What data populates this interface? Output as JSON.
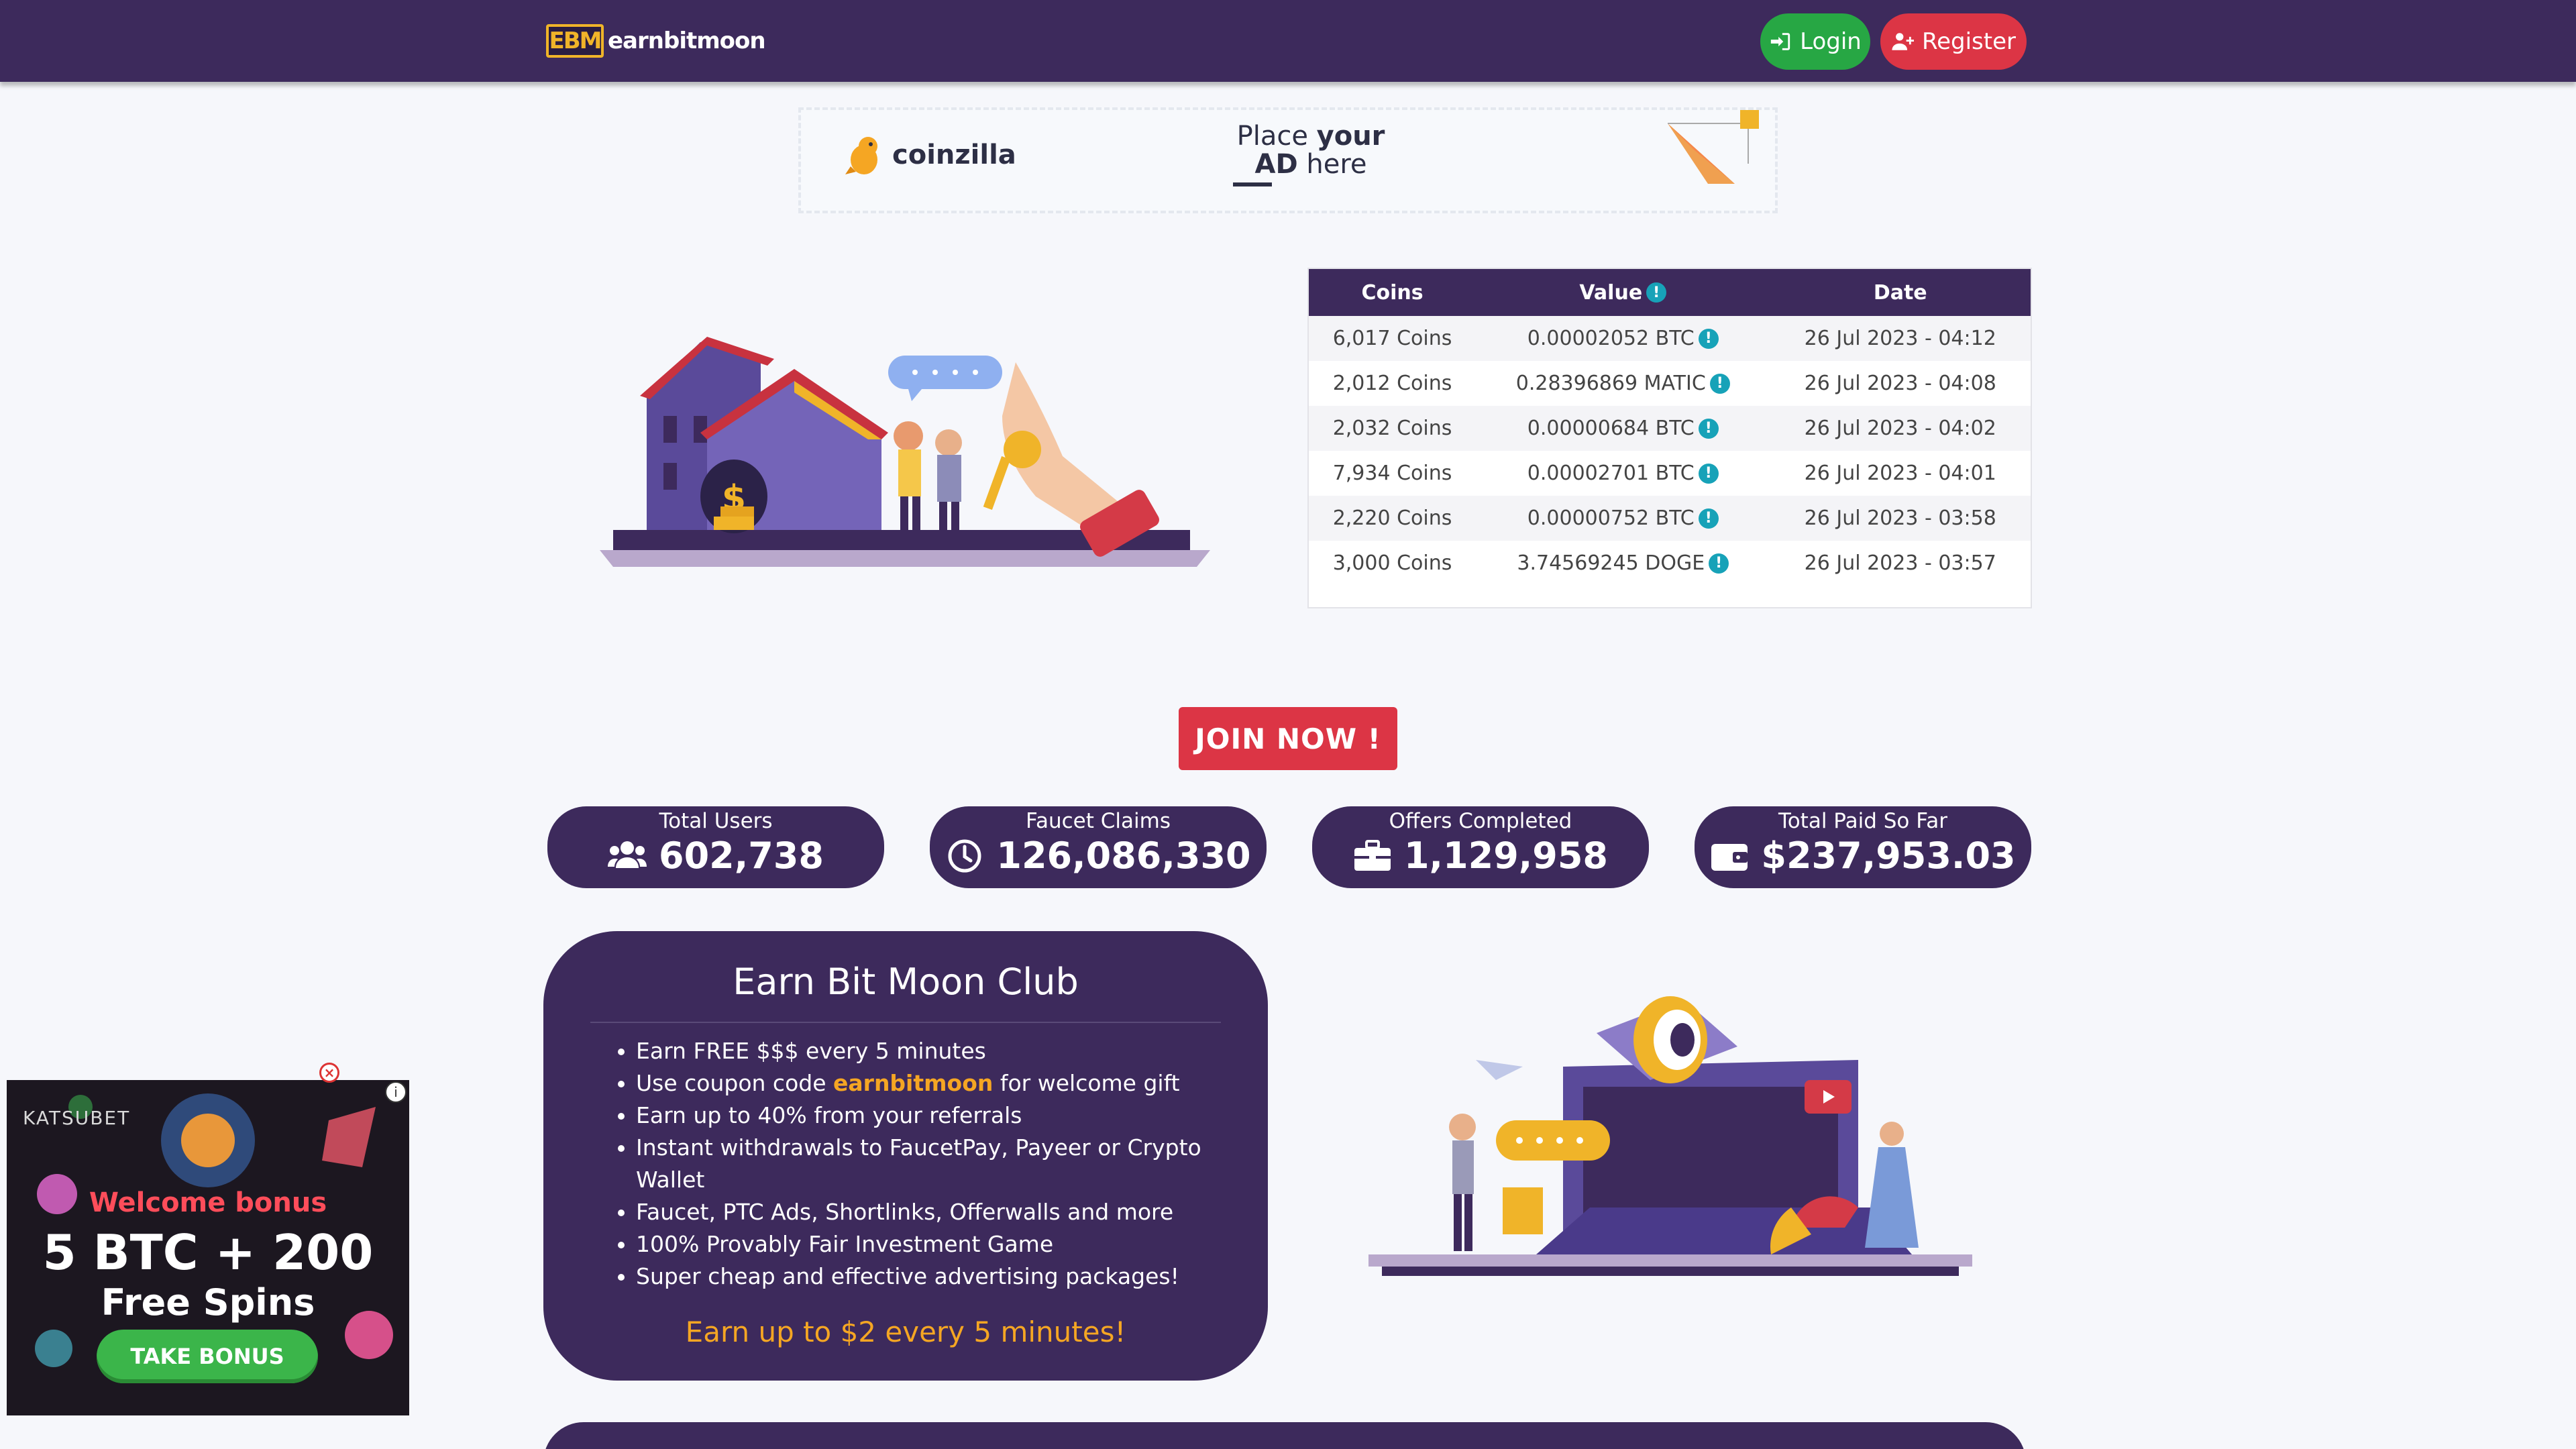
{
  "header": {
    "logo_mark": "EBM",
    "logo_text": "earnbitmoon",
    "login_label": "Login",
    "register_label": "Register"
  },
  "top_ad": {
    "brand": "coinzilla",
    "line1_a": "Place ",
    "line1_b": "your",
    "line2_a": "AD",
    "line2_b": " here"
  },
  "table": {
    "headers": [
      "Coins",
      "Value",
      "Date"
    ],
    "rows": [
      {
        "coins": "6,017 Coins",
        "value": "0.00002052 BTC",
        "date": "26 Jul 2023 - 04:12"
      },
      {
        "coins": "2,012 Coins",
        "value": "0.28396869 MATIC",
        "date": "26 Jul 2023 - 04:08"
      },
      {
        "coins": "2,032 Coins",
        "value": "0.00000684 BTC",
        "date": "26 Jul 2023 - 04:02"
      },
      {
        "coins": "7,934 Coins",
        "value": "0.00002701 BTC",
        "date": "26 Jul 2023 - 04:01"
      },
      {
        "coins": "2,220 Coins",
        "value": "0.00000752 BTC",
        "date": "26 Jul 2023 - 03:58"
      },
      {
        "coins": "3,000 Coins",
        "value": "3.74569245 DOGE",
        "date": "26 Jul 2023 - 03:57"
      }
    ]
  },
  "join_label": "JOIN NOW !",
  "stats": [
    {
      "label": "Total Users",
      "value": "602,738",
      "icon": "users-icon"
    },
    {
      "label": "Faucet Claims",
      "value": "126,086,330",
      "icon": "clock-icon"
    },
    {
      "label": "Offers Completed",
      "value": "1,129,958",
      "icon": "briefcase-icon"
    },
    {
      "label": "Total Paid So Far",
      "value": "$237,953.03",
      "icon": "wallet-icon"
    }
  ],
  "club": {
    "title": "Earn Bit Moon Club",
    "items": [
      "Earn FREE $$$ every 5 minutes",
      "Use coupon code ",
      "Earn up to 40% from your referrals",
      "Instant withdrawals to FaucetPay, Payeer or Crypto Wallet",
      "Faucet, PTC Ads, Shortlinks, Offerwalls and more",
      "100% Provably Fair Investment Game",
      "Super cheap and effective advertising packages!"
    ],
    "coupon_code": "earnbitmoon",
    "coupon_suffix": " for welcome gift",
    "cta": "Earn up to $2 every 5 minutes!"
  },
  "side_ad": {
    "brand": "KATSUBET",
    "welcome": "Welcome bonus",
    "headline": "5 BTC + 200",
    "subline": "Free Spins",
    "cta": "TAKE BONUS"
  },
  "colors": {
    "primary": "#3d2a5c",
    "success": "#27a744",
    "danger": "#dc3545",
    "accent": "#f5a623",
    "info": "#17a2b8"
  }
}
